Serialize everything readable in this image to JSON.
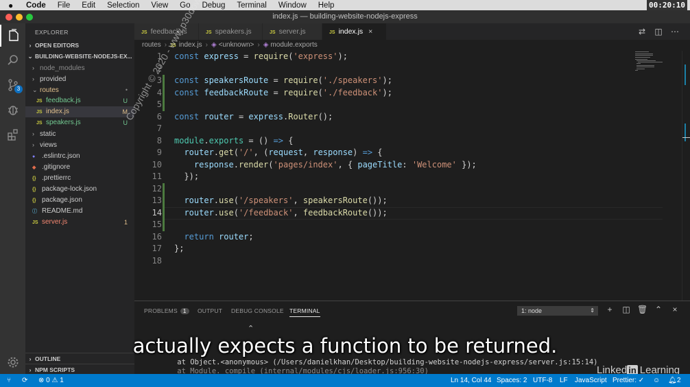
{
  "menubar": {
    "items": [
      "Code",
      "File",
      "Edit",
      "Selection",
      "View",
      "Go",
      "Debug",
      "Terminal",
      "Window",
      "Help"
    ],
    "clock": "00:20:10"
  },
  "window": {
    "title": "index.js — building-website-nodejs-express"
  },
  "activity_bar": {
    "icons": [
      "explorer-icon",
      "search-icon",
      "source-control-icon",
      "debug-icon",
      "extensions-icon",
      "settings-icon"
    ],
    "scm_badge": "3"
  },
  "sidebar": {
    "title": "EXPLORER",
    "open_editors": "OPEN EDITORS",
    "project": "BUILDING-WEBSITE-NODEJS-EX...",
    "tree": [
      {
        "label": "node_modules",
        "kind": "folder",
        "status": ""
      },
      {
        "label": "provided",
        "kind": "folder",
        "status": ""
      },
      {
        "label": "routes",
        "kind": "folder-open",
        "status": "•"
      },
      {
        "label": "feedback.js",
        "kind": "js",
        "status": "U"
      },
      {
        "label": "index.js",
        "kind": "js",
        "status": "M"
      },
      {
        "label": "speakers.js",
        "kind": "js",
        "status": "U"
      },
      {
        "label": "static",
        "kind": "folder",
        "status": ""
      },
      {
        "label": "views",
        "kind": "folder",
        "status": ""
      },
      {
        "label": ".eslintrc.json",
        "kind": "eslint",
        "status": ""
      },
      {
        "label": ".gitignore",
        "kind": "git",
        "status": ""
      },
      {
        "label": ".prettierrc",
        "kind": "json",
        "status": ""
      },
      {
        "label": "package-lock.json",
        "kind": "json",
        "status": ""
      },
      {
        "label": "package.json",
        "kind": "json",
        "status": ""
      },
      {
        "label": "README.md",
        "kind": "md",
        "status": ""
      },
      {
        "label": "server.js",
        "kind": "js",
        "status": "1"
      }
    ],
    "outline": "OUTLINE",
    "npm_scripts": "NPM SCRIPTS"
  },
  "tabs": [
    {
      "label": "feedback.js",
      "icon": "JS",
      "active": false
    },
    {
      "label": "speakers.js",
      "icon": "JS",
      "active": false
    },
    {
      "label": "server.js",
      "icon": "JS",
      "active": false
    },
    {
      "label": "index.js",
      "icon": "JS",
      "active": true,
      "close": "×"
    }
  ],
  "breadcrumbs": [
    "routes",
    "index.js",
    "<unknown>",
    "module.exports"
  ],
  "breadcrumb_js_icon": "JS",
  "editor": {
    "lines": [
      [
        [
          "kw",
          "const "
        ],
        [
          "vr",
          "express"
        ],
        [
          "pn",
          " = "
        ],
        [
          "fn",
          "require"
        ],
        [
          "pn",
          "("
        ],
        [
          "sr",
          "'express'"
        ],
        [
          "pn",
          ");"
        ]
      ],
      [],
      [
        [
          "kw",
          "const "
        ],
        [
          "vr",
          "speakersRoute"
        ],
        [
          "pn",
          " = "
        ],
        [
          "fn",
          "require"
        ],
        [
          "pn",
          "("
        ],
        [
          "sr",
          "'./speakers'"
        ],
        [
          "pn",
          ");"
        ]
      ],
      [
        [
          "kw",
          "const "
        ],
        [
          "vr",
          "feedbackRoute"
        ],
        [
          "pn",
          " = "
        ],
        [
          "fn",
          "require"
        ],
        [
          "pn",
          "("
        ],
        [
          "sr",
          "'./feedback'"
        ],
        [
          "pn",
          ");"
        ]
      ],
      [],
      [
        [
          "kw",
          "const "
        ],
        [
          "vr",
          "router"
        ],
        [
          "pn",
          " = "
        ],
        [
          "vr",
          "express"
        ],
        [
          "pn",
          "."
        ],
        [
          "fn",
          "Router"
        ],
        [
          "pn",
          "();"
        ]
      ],
      [],
      [
        [
          "ty",
          "module"
        ],
        [
          "pn",
          "."
        ],
        [
          "ty",
          "exports"
        ],
        [
          "pn",
          " = () "
        ],
        [
          "kw",
          "=>"
        ],
        [
          "pn",
          " {"
        ]
      ],
      [
        [
          "vr",
          "  router"
        ],
        [
          "pn",
          "."
        ],
        [
          "fn",
          "get"
        ],
        [
          "pn",
          "("
        ],
        [
          "sr",
          "'/'"
        ],
        [
          "pn",
          ", ("
        ],
        [
          "vr",
          "request"
        ],
        [
          "pn",
          ", "
        ],
        [
          "vr",
          "response"
        ],
        [
          "pn",
          ") "
        ],
        [
          "kw",
          "=>"
        ],
        [
          "pn",
          " {"
        ]
      ],
      [
        [
          "vr",
          "    response"
        ],
        [
          "pn",
          "."
        ],
        [
          "fn",
          "render"
        ],
        [
          "pn",
          "("
        ],
        [
          "sr",
          "'pages/index'"
        ],
        [
          "pn",
          ", { "
        ],
        [
          "vr",
          "pageTitle"
        ],
        [
          "pn",
          ": "
        ],
        [
          "sr",
          "'Welcome'"
        ],
        [
          "pn",
          " });"
        ]
      ],
      [
        [
          "pn",
          "  });"
        ]
      ],
      [],
      [
        [
          "vr",
          "  router"
        ],
        [
          "pn",
          "."
        ],
        [
          "fn",
          "use"
        ],
        [
          "pn",
          "("
        ],
        [
          "sr",
          "'/speakers'"
        ],
        [
          "pn",
          ", "
        ],
        [
          "fn",
          "speakersRoute"
        ],
        [
          "pn",
          "());"
        ]
      ],
      [
        [
          "vr",
          "  router"
        ],
        [
          "pn",
          "."
        ],
        [
          "fn",
          "use"
        ],
        [
          "pn",
          "("
        ],
        [
          "sr",
          "'/feedback'"
        ],
        [
          "pn",
          ", "
        ],
        [
          "fn",
          "feedbackRoute"
        ],
        [
          "pn",
          "());"
        ]
      ],
      [],
      [
        [
          "kw",
          "  return "
        ],
        [
          "vr",
          "router"
        ],
        [
          "pn",
          ";"
        ]
      ],
      [
        [
          "pn",
          "};"
        ]
      ],
      []
    ],
    "current_line": 14,
    "modified_lines": [
      3,
      4,
      5,
      12,
      13,
      14,
      15
    ]
  },
  "watermark": "Copyright © 2020 - www.p30download.com",
  "panel": {
    "tabs": [
      {
        "label": "PROBLEMS",
        "count": "1",
        "active": false
      },
      {
        "label": "OUTPUT",
        "active": false
      },
      {
        "label": "DEBUG CONSOLE",
        "active": false
      },
      {
        "label": "TERMINAL",
        "active": true
      }
    ],
    "terminal_select": "1: node",
    "terminal_lines": [
      "    at Object.<anonymous> (/Users/danielkhan/Desktop/building-website-nodejs-express/server.js:15:14)",
      "    at Module._compile (internal/modules/cjs/loader.js:956:30)"
    ]
  },
  "caption": "actually expects a function to be returned.",
  "brand": {
    "linked": "Linked",
    "in": "in",
    "learning": "Learning"
  },
  "statusbar": {
    "problems": "⊗ 0 ⚠ 1",
    "position": "Ln 14, Col 44",
    "spaces": "Spaces: 2",
    "encoding": "UTF-8",
    "eol": "LF",
    "language": "JavaScript",
    "formatter": "Prettier: ✓",
    "notifications": "2"
  },
  "colors": {
    "accent": "#007acc",
    "activity": "#333333",
    "sidebar": "#252526",
    "editor": "#1e1e1e",
    "modified_gutter": "#4c7a3f"
  }
}
